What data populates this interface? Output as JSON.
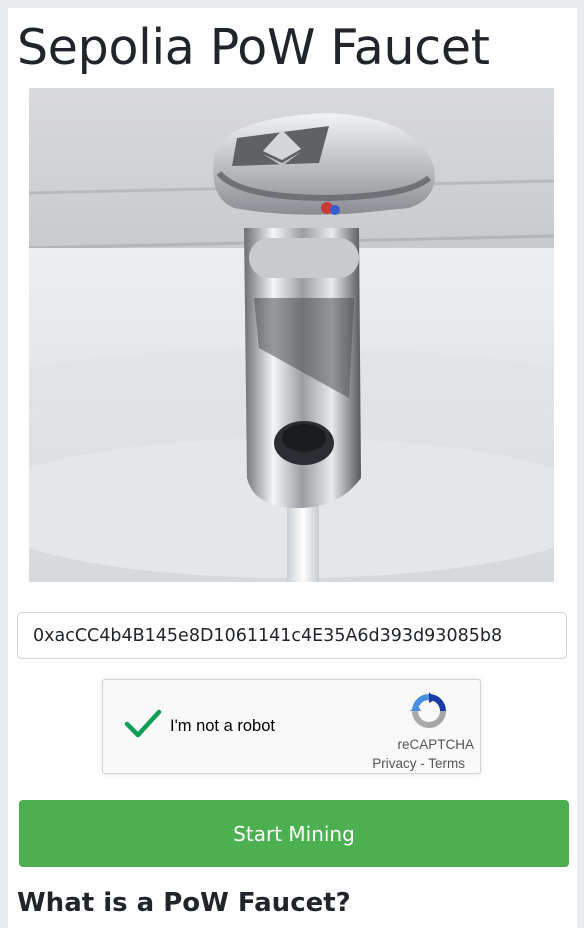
{
  "page": {
    "title": "Sepolia PoW Faucet",
    "hero_image": "faucet-tap-with-ethereum-logo"
  },
  "address": {
    "value": "0xacCC4b4B145e8D1061141c4E35A6d393d93085b8"
  },
  "captcha": {
    "label": "I'm not a robot",
    "checked": true,
    "brand": "reCAPTCHA",
    "privacy": "Privacy",
    "separator": " - ",
    "terms": "Terms",
    "check_color": "#0f9d58"
  },
  "actions": {
    "start_label": "Start Mining",
    "button_color": "#4caf50"
  },
  "info": {
    "heading": "What is a PoW Faucet?"
  }
}
